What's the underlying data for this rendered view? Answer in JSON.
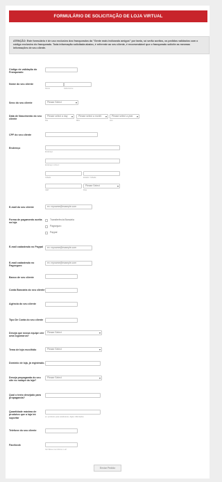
{
  "title": "FORMULÁRIO DE SOLICITAÇÃO DE LOJA VIRTUAL",
  "notice": "ATENÇÃO: Este formulário é de uso exclusivo dos franqueados da \"Gente mais indicando amigos\" por tanto, só serão aceitos, os pedidos validados com o código exclusivo do franqueado. Toda informação solicitada abaixo, é referente ao seu cliente, é recomendável que o franqueado solicite as mesmas informações de seu cliente.",
  "labels": {
    "codigo": "Código de validação do Franqueado",
    "nome": "Nome do seu cliente",
    "sexo": "Sexo do seu cliente",
    "nascimento": "Data de Nascimento do seu cliente",
    "cpf": "CPF do seu cliente",
    "endereco": "Endereço",
    "email": "E-mail do seu cliente",
    "pagamento": "Forma de pagamento aceita na loja",
    "paypal": "E-mail cadastrado no Paypal",
    "pagseguro": "E-mail cadastrado no Pagseguro",
    "banco": "Banco de seu cliente",
    "conta": "Conta Bancária do seu cliente",
    "agencia": "Agência do seu cliente",
    "tipo_conta": "Tipo De Conta do seu cliente",
    "equipe": "Deseja que nossa equipe crie uma logomarca?",
    "tema": "Tema de loja escolhido",
    "dominio": "Domínio de loja, já registrado.",
    "propaganda": "Deseja propaganda do seu site no rodapé da loja?",
    "texto": "Qual o texto desejado para propaganda?",
    "quantidade": "Quantidade máxima de produtos que a loja irá suportar",
    "telefone": "Telefone do seu cliente",
    "facebook": "Facebook"
  },
  "sublabels": {
    "first": "Nome",
    "last": "Sobrenome",
    "dia": "Dia",
    "mes": "Mês",
    "ano": "Ano",
    "endereco": "Endereço",
    "endereco2": "Endereço Linha 2",
    "cidade": "Cidade",
    "estado": "Estado / Cidade",
    "cep": "CEP",
    "pais": "País",
    "quantidade": "ex: produtos para estabelecer, digite 1/Ilimitados",
    "facebook": "Ver fãnes nos informe o url"
  },
  "placeholders": {
    "email": "ex: myname@example.com"
  },
  "selects": {
    "please_select": "Please Select",
    "day": "Please select a day",
    "month": "Please select a month",
    "year": "Please select a year"
  },
  "payment_options": [
    "Transferência Bancária",
    "Pagseguro",
    "Paypal"
  ],
  "submit": "Enviar Pedido"
}
